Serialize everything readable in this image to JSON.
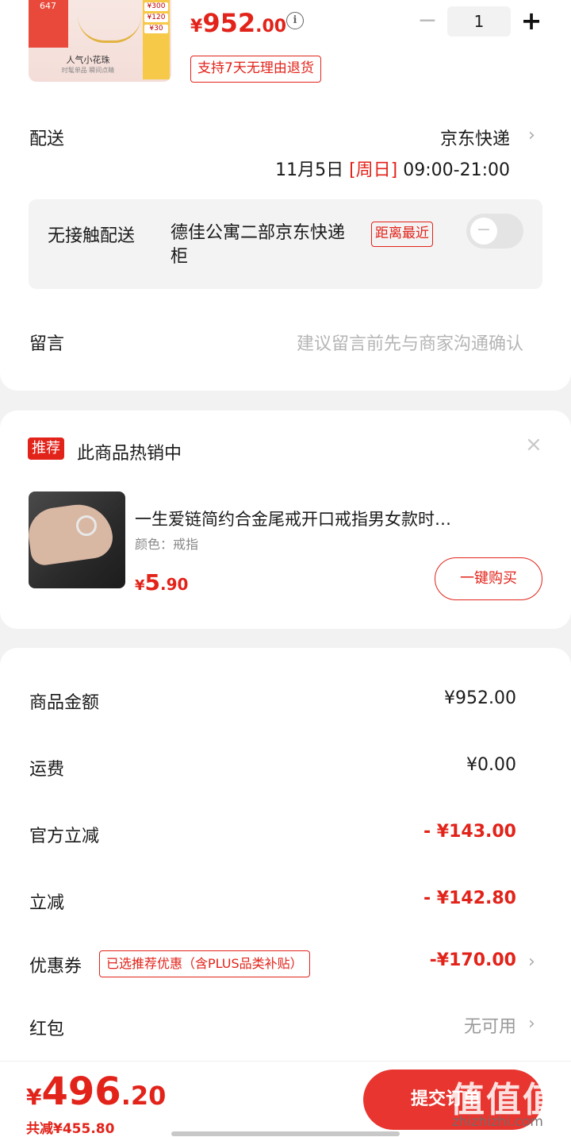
{
  "product": {
    "thumb_badge": "647",
    "thumb_side_values": [
      "¥300",
      "¥120",
      "¥30"
    ],
    "thumb_title": "人气小花珠",
    "thumb_sub": "时髦单品 瞬间点睛",
    "price_symbol": "¥",
    "price_int": "952",
    "price_dec": ".00",
    "info_icon": "i",
    "return_tag": "支持7天无理由退货",
    "qty_minus": "−",
    "qty_value": "1",
    "qty_plus": "+"
  },
  "shipping": {
    "label": "配送",
    "method": "京东快递",
    "date": "11月5日",
    "weekday": "[周日]",
    "time": "09:00-21:00"
  },
  "contactless": {
    "label": "无接触配送",
    "address": "德佳公寓二部京东快递柜",
    "tag": "距离最近",
    "toggle_on": false
  },
  "note": {
    "label": "留言",
    "placeholder": "建议留言前先与商家沟通确认"
  },
  "recommendation": {
    "tag": "推荐",
    "title": "此商品热销中",
    "close": "×",
    "item_name": "一生爱链简约合金尾戒开口戒指男女款时…",
    "item_spec": "颜色：戒指",
    "price_symbol": "¥",
    "price_int": "5",
    "price_dec": ".90",
    "buy_label": "一键购买"
  },
  "summary": {
    "goods_label": "商品金额",
    "goods_value": "¥952.00",
    "freight_label": "运费",
    "freight_value": "¥0.00",
    "official_label": "官方立减",
    "official_value": "- ¥143.00",
    "instant_label": "立减",
    "instant_value": "- ¥142.80",
    "coupon_label": "优惠券",
    "coupon_tag": "已选推荐优惠（含PLUS品类补贴）",
    "coupon_value": "-¥170.00",
    "redpacket_label": "红包",
    "redpacket_value": "无可用"
  },
  "bottom": {
    "total_symbol": "¥",
    "total_int": "496",
    "total_dec": ".20",
    "saved": "共减¥455.80",
    "submit": "提交订单",
    "watermark": "值值值",
    "watermark_url": "zhizhizhi.com"
  },
  "colors": {
    "accent": "#e2231a",
    "button": "#e8352f"
  }
}
